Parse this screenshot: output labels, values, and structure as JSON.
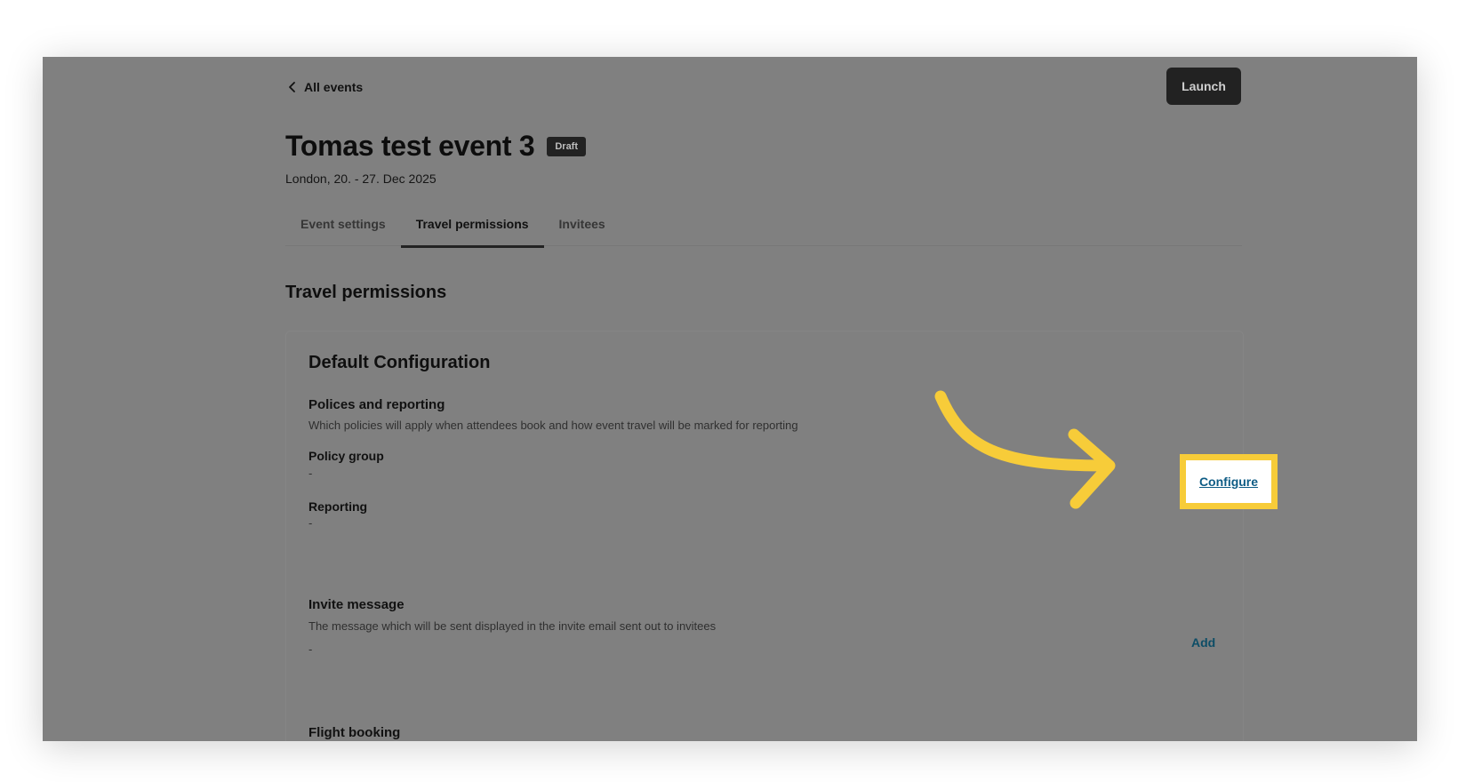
{
  "header": {
    "back_label": "All events",
    "launch_label": "Launch"
  },
  "event": {
    "title": "Tomas test event 3",
    "status_badge": "Draft",
    "subtitle": "London, 20. - 27. Dec 2025"
  },
  "tabs": [
    {
      "label": "Event settings",
      "active": false
    },
    {
      "label": "Travel permissions",
      "active": true
    },
    {
      "label": "Invitees",
      "active": false
    }
  ],
  "main": {
    "heading": "Travel permissions",
    "card": {
      "title": "Default Configuration",
      "policies": {
        "label": "Polices and reporting",
        "description": "Which policies will apply when attendees book and how event travel will be marked for reporting",
        "configure_label": "Configure"
      },
      "policy_group": {
        "label": "Policy group",
        "value": "-"
      },
      "reporting": {
        "label": "Reporting",
        "value": "-"
      },
      "invite_message": {
        "label": "Invite message",
        "description": "The message which will be sent displayed in the invite email sent out to invitees",
        "value": "-",
        "add_label": "Add"
      },
      "flight_booking": {
        "label": "Flight booking"
      }
    }
  },
  "annotation": {
    "highlight_color": "#f7cc39",
    "icon": "curved-arrow-icon"
  }
}
